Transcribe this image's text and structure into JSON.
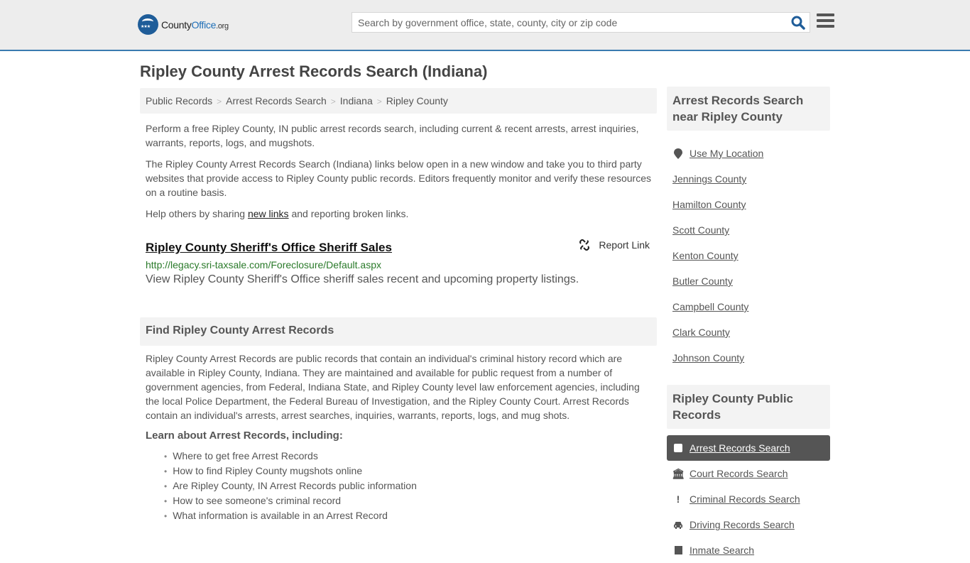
{
  "header": {
    "logo": {
      "part1": "County",
      "part2": "Office",
      "part3": ".org"
    },
    "search_placeholder": "Search by government office, state, county, city or zip code",
    "search_value": ""
  },
  "page_title": "Ripley County Arrest Records Search (Indiana)",
  "breadcrumb": [
    "Public Records",
    "Arrest Records Search",
    "Indiana",
    "Ripley County"
  ],
  "intro": {
    "p1": "Perform a free Ripley County, IN public arrest records search, including current & recent arrests, arrest inquiries, warrants, reports, logs, and mugshots.",
    "p2": "The Ripley County Arrest Records Search (Indiana) links below open in a new window and take you to third party websites that provide access to Ripley County public records. Editors frequently monitor and verify these resources on a routine basis.",
    "p3_before": "Help others by sharing ",
    "p3_link": "new links",
    "p3_after": " and reporting broken links."
  },
  "result": {
    "title": "Ripley County Sheriff's Office Sheriff Sales",
    "url": "http://legacy.sri-taxsale.com/Foreclosure/Default.aspx",
    "description": "View Ripley County Sheriff's Office sheriff sales recent and upcoming property listings.",
    "report_label": "Report Link"
  },
  "find_section": {
    "heading": "Find Ripley County Arrest Records",
    "body": "Ripley County Arrest Records are public records that contain an individual's criminal history record which are available in Ripley County, Indiana. They are maintained and available for public request from a number of government agencies, from Federal, Indiana State, and Ripley County level law enforcement agencies, including the local Police Department, the Federal Bureau of Investigation, and the Ripley County Court. Arrest Records contain an individual's arrests, arrest searches, inquiries, warrants, reports, logs, and mug shots.",
    "learn_heading": "Learn about Arrest Records, including:",
    "learn_items": [
      "Where to get free Arrest Records",
      "How to find Ripley County mugshots online",
      "Are Ripley County, IN Arrest Records public information",
      "How to see someone's criminal record",
      "What information is available in an Arrest Record"
    ]
  },
  "sidebar": {
    "nearby_heading": "Arrest Records Search near Ripley County",
    "use_location": "Use My Location",
    "nearby": [
      "Jennings County",
      "Hamilton County",
      "Scott County",
      "Kenton County",
      "Butler County",
      "Campbell County",
      "Clark County",
      "Johnson County"
    ],
    "public_heading": "Ripley County Public Records",
    "public_records": [
      {
        "label": "Arrest Records Search",
        "icon": "square-icon",
        "active": true
      },
      {
        "label": "Court Records Search",
        "icon": "courthouse-icon",
        "active": false
      },
      {
        "label": "Criminal Records Search",
        "icon": "exclamation-icon",
        "active": false
      },
      {
        "label": "Driving Records Search",
        "icon": "car-icon",
        "active": false
      },
      {
        "label": "Inmate Search",
        "icon": "inmate-icon",
        "active": false
      }
    ]
  },
  "colors": {
    "brand": "#1f5d99",
    "header_rule": "#3a7bb0",
    "url_green": "#2a7a2a",
    "active_bg": "#555555"
  }
}
